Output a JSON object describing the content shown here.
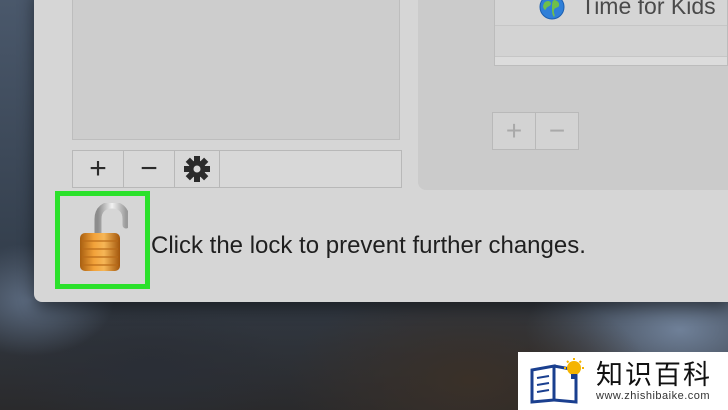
{
  "users_list": {
    "toolbar": {
      "add_label": "+",
      "remove_label": "−",
      "gear_icon": "gear-icon"
    }
  },
  "websites": {
    "rows": [
      {
        "icon": "globe-icon",
        "label": "Time for Kids"
      }
    ],
    "add_label": "+",
    "remove_label": "−"
  },
  "lock": {
    "icon": "unlocked-padlock-icon",
    "message": "Click the lock to prevent further changes.",
    "highlight_color": "#2be12b"
  },
  "watermark": {
    "title": "知识百科",
    "url": "www.zhishibaike.com"
  }
}
